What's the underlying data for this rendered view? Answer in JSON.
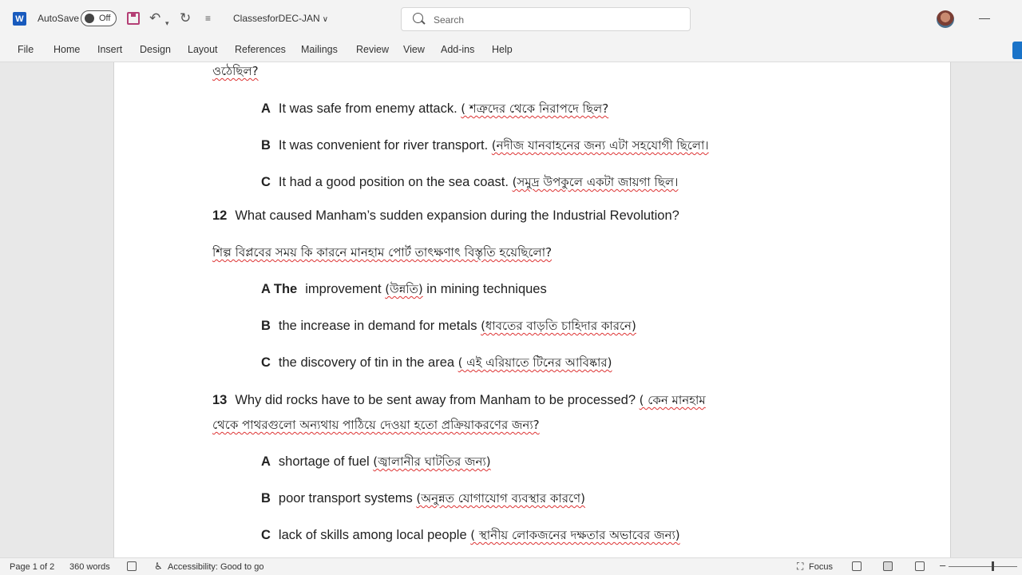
{
  "app": {
    "autosave_label": "AutoSave",
    "autosave_state": "Off",
    "doc_title": "ClassesforDEC-JAN",
    "search_placeholder": "Search",
    "accent": "#185abd"
  },
  "ribbon": {
    "tabs": [
      "File",
      "Home",
      "Insert",
      "Design",
      "Layout",
      "References",
      "Mailings",
      "Review",
      "View",
      "Add-ins",
      "Help"
    ]
  },
  "document": {
    "lines": [
      {
        "bn": "ওঠেছিল?"
      },
      {
        "letter": "A",
        "en": "It was safe from enemy attack.",
        "bn": "( শত্রুদের থেকে নিরাপদে ছিল?"
      },
      {
        "letter": "B",
        "en": "It was convenient for river transport.",
        "bn": "(নদীজ যানবাহনের জন্য এটা সহযোগী ছিলো।"
      },
      {
        "letter": "C",
        "en": "It had a good position on the sea coast.",
        "bn": "(সমুদ্র উপকুলে একটা জায়গা ছিল।"
      },
      {
        "num": "12",
        "en": "What caused Manham’s sudden expansion during the Industrial Revolution?"
      },
      {
        "bn": "শিল্প বিপ্লবের সময় কি কারনে মানহাম পোর্ট তাৎক্ষণাৎ বিস্তৃতি হয়েছিলো?"
      },
      {
        "letter": "A The",
        "en": "improvement",
        "bn": "(উন্নতি)",
        "en2": "in mining techniques"
      },
      {
        "letter": "B",
        "en": "the increase in demand for metals",
        "bn": "(ধাবতের বাড়তি চাহিদার কারনে)"
      },
      {
        "letter": "C",
        "en": "the discovery of tin in the area",
        "bn": "( এই এরিয়াতে টিনের আবিষ্কার)"
      },
      {
        "num": "13",
        "en": "Why did rocks have to be sent away from Manham to be processed?",
        "bn": "( কেন মানহাম"
      },
      {
        "bn": "থেকে পাথরগুলো অন্যথায় পাঠিয়ে দেওয়া হতো প্রক্রিয়াকরণের জন্য?"
      },
      {
        "letter": "A",
        "en": "shortage of fuel",
        "bn": "(জ্বালানীর ঘাটতির জন্য)"
      },
      {
        "letter": "B",
        "en": "poor transport systems",
        "bn": "(অনুন্নত যোগাযোগ ব্যবস্থার কারণে)"
      },
      {
        "letter": "C",
        "en": "lack of skills among local people",
        "bn": "( স্থানীয় লোকজনের দক্ষতার অভাবের জন্য)"
      }
    ]
  },
  "status": {
    "page": "Page 1 of 2",
    "words": "360 words",
    "accessibility": "Accessibility: Good to go",
    "focus": "Focus"
  }
}
